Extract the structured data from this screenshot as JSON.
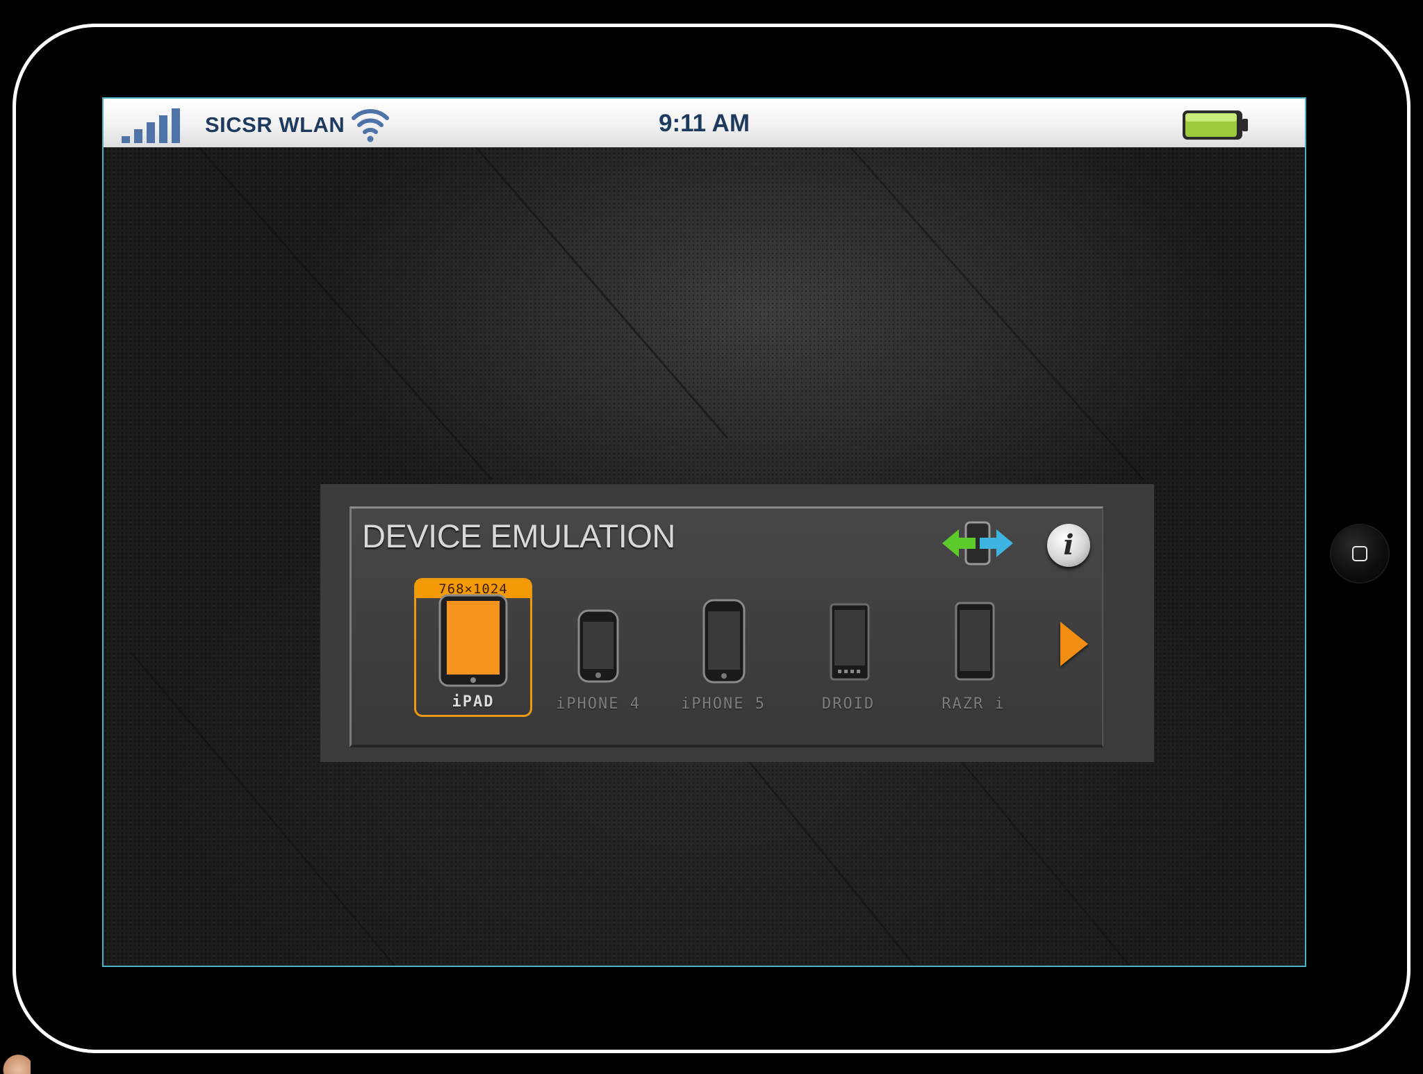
{
  "status_bar": {
    "carrier": "SICSR WLAN",
    "time": "9:11 AM"
  },
  "panel": {
    "title": "DEVICE EMULATION",
    "info_glyph": "i"
  },
  "devices": [
    {
      "label": "iPAD",
      "resolution": "768×1024",
      "selected": true
    },
    {
      "label": "iPHONE 4",
      "selected": false
    },
    {
      "label": "iPHONE 5",
      "selected": false
    },
    {
      "label": "DROID",
      "selected": false
    },
    {
      "label": "RAZR i",
      "selected": false
    }
  ],
  "icons": {
    "signal": "signal-strength-icon",
    "wifi": "wifi-icon",
    "battery": "battery-icon",
    "orientation": "rotate-orientation-icon",
    "info": "info-icon",
    "next": "next-arrow-icon",
    "home": "home-button-icon"
  },
  "colors": {
    "accent": "#f59a07",
    "status_text": "#1f3a5f",
    "battery_fill": "#9ccc3d",
    "screen_border": "#4fb3c8"
  }
}
